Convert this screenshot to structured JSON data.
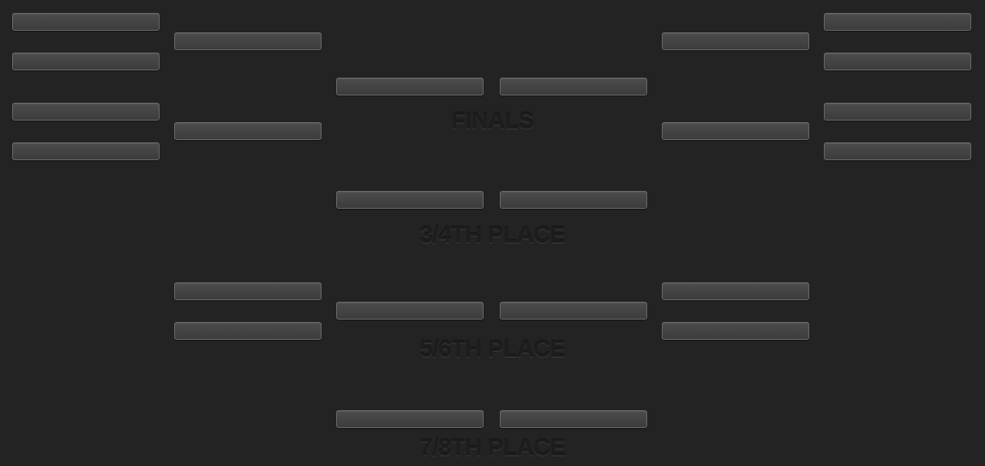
{
  "labels": {
    "finals": "FINALS",
    "third_fourth": "3/4TH PLACE",
    "fifth_sixth": "5/6TH PLACE",
    "seventh_eighth": "7/8TH PLACE"
  },
  "slots": {
    "empty_value": ""
  },
  "colors": {
    "background": "#232323",
    "slot_fill": "#444444",
    "slot_border": "#6a6a6a",
    "label_text": "#1d1d1d"
  }
}
